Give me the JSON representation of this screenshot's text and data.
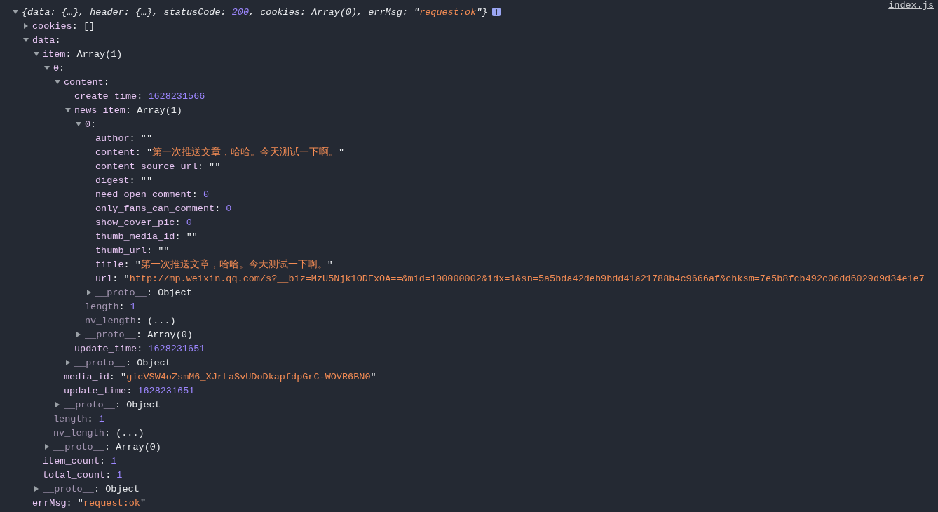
{
  "console": {
    "source_link": "index.js",
    "entry": {
      "expanded": true,
      "preview": [
        {
          "kind": "plain",
          "text": "{data: {…}, header: {…}, statusCode: "
        },
        {
          "kind": "number",
          "text": "200"
        },
        {
          "kind": "plain",
          "text": ", cookies: Array(0), errMsg: "
        },
        {
          "kind": "quote",
          "text": "\""
        },
        {
          "kind": "string",
          "text": "request:ok"
        },
        {
          "kind": "quote",
          "text": "\""
        },
        {
          "kind": "plain",
          "text": "}"
        }
      ],
      "children": [
        {
          "kind": "branch",
          "expanded": false,
          "dimmed": false,
          "key": "cookies:",
          "value": [
            {
              "kind": "plain",
              "text": "[]"
            }
          ]
        },
        {
          "kind": "branch",
          "expanded": true,
          "dimmed": false,
          "key": "data:",
          "children": [
            {
              "kind": "branch",
              "expanded": true,
              "dimmed": false,
              "key": "item:",
              "value": [
                {
                  "kind": "plain",
                  "text": "Array(1)"
                }
              ],
              "children": [
                {
                  "kind": "branch",
                  "expanded": true,
                  "dimmed": false,
                  "key": "0:",
                  "children": [
                    {
                      "kind": "branch",
                      "expanded": true,
                      "dimmed": false,
                      "key": "content:",
                      "children": [
                        {
                          "kind": "leaf",
                          "dimmed": false,
                          "key": "create_time:",
                          "value": [
                            {
                              "kind": "number",
                              "text": "1628231566"
                            }
                          ]
                        },
                        {
                          "kind": "branch",
                          "expanded": true,
                          "dimmed": false,
                          "key": "news_item:",
                          "value": [
                            {
                              "kind": "plain",
                              "text": "Array(1)"
                            }
                          ],
                          "children": [
                            {
                              "kind": "branch",
                              "expanded": true,
                              "dimmed": false,
                              "key": "0:",
                              "children": [
                                {
                                  "kind": "leaf",
                                  "dimmed": false,
                                  "key": "author:",
                                  "value": [
                                    {
                                      "kind": "quote",
                                      "text": "\"\""
                                    }
                                  ]
                                },
                                {
                                  "kind": "leaf",
                                  "dimmed": false,
                                  "key": "content:",
                                  "value": [
                                    {
                                      "kind": "quote",
                                      "text": "\""
                                    },
                                    {
                                      "kind": "string",
                                      "text": "第一次推送文章，哈哈。今天测试一下啊。"
                                    },
                                    {
                                      "kind": "quote",
                                      "text": "\""
                                    }
                                  ]
                                },
                                {
                                  "kind": "leaf",
                                  "dimmed": false,
                                  "key": "content_source_url:",
                                  "value": [
                                    {
                                      "kind": "quote",
                                      "text": "\"\""
                                    }
                                  ]
                                },
                                {
                                  "kind": "leaf",
                                  "dimmed": false,
                                  "key": "digest:",
                                  "value": [
                                    {
                                      "kind": "quote",
                                      "text": "\"\""
                                    }
                                  ]
                                },
                                {
                                  "kind": "leaf",
                                  "dimmed": false,
                                  "key": "need_open_comment:",
                                  "value": [
                                    {
                                      "kind": "number",
                                      "text": "0"
                                    }
                                  ]
                                },
                                {
                                  "kind": "leaf",
                                  "dimmed": false,
                                  "key": "only_fans_can_comment:",
                                  "value": [
                                    {
                                      "kind": "number",
                                      "text": "0"
                                    }
                                  ]
                                },
                                {
                                  "kind": "leaf",
                                  "dimmed": false,
                                  "key": "show_cover_pic:",
                                  "value": [
                                    {
                                      "kind": "number",
                                      "text": "0"
                                    }
                                  ]
                                },
                                {
                                  "kind": "leaf",
                                  "dimmed": false,
                                  "key": "thumb_media_id:",
                                  "value": [
                                    {
                                      "kind": "quote",
                                      "text": "\"\""
                                    }
                                  ]
                                },
                                {
                                  "kind": "leaf",
                                  "dimmed": false,
                                  "key": "thumb_url:",
                                  "value": [
                                    {
                                      "kind": "quote",
                                      "text": "\"\""
                                    }
                                  ]
                                },
                                {
                                  "kind": "leaf",
                                  "dimmed": false,
                                  "key": "title:",
                                  "value": [
                                    {
                                      "kind": "quote",
                                      "text": "\""
                                    },
                                    {
                                      "kind": "string",
                                      "text": "第一次推送文章，哈哈。今天测试一下啊。"
                                    },
                                    {
                                      "kind": "quote",
                                      "text": "\""
                                    }
                                  ]
                                },
                                {
                                  "kind": "leaf",
                                  "dimmed": false,
                                  "key": "url:",
                                  "value": [
                                    {
                                      "kind": "quote",
                                      "text": "\""
                                    },
                                    {
                                      "kind": "string",
                                      "text": "http://mp.weixin.qq.com/s?__biz=MzU5Njk1ODExOA==&mid=100000002&idx=1&sn=5a5bda42deb9bdd41a21788b4c9666af&chksm=7e5b8fcb492c06dd6029d9d34e1e7"
                                    }
                                  ]
                                },
                                {
                                  "kind": "branch",
                                  "expanded": false,
                                  "dimmed": true,
                                  "key": "__proto__:",
                                  "value": [
                                    {
                                      "kind": "plain",
                                      "text": "Object"
                                    }
                                  ]
                                }
                              ]
                            },
                            {
                              "kind": "leaf",
                              "dimmed": true,
                              "key": "length:",
                              "value": [
                                {
                                  "kind": "number",
                                  "text": "1"
                                }
                              ]
                            },
                            {
                              "kind": "leaf",
                              "dimmed": true,
                              "key": "nv_length:",
                              "value": [
                                {
                                  "kind": "plain",
                                  "text": "(...)"
                                }
                              ]
                            },
                            {
                              "kind": "branch",
                              "expanded": false,
                              "dimmed": true,
                              "key": "__proto__:",
                              "value": [
                                {
                                  "kind": "plain",
                                  "text": "Array(0)"
                                }
                              ]
                            }
                          ]
                        },
                        {
                          "kind": "leaf",
                          "dimmed": false,
                          "key": "update_time:",
                          "value": [
                            {
                              "kind": "number",
                              "text": "1628231651"
                            }
                          ]
                        },
                        {
                          "kind": "branch",
                          "expanded": false,
                          "dimmed": true,
                          "key": "__proto__:",
                          "value": [
                            {
                              "kind": "plain",
                              "text": "Object"
                            }
                          ]
                        }
                      ]
                    },
                    {
                      "kind": "leaf",
                      "dimmed": false,
                      "key": "media_id:",
                      "value": [
                        {
                          "kind": "quote",
                          "text": "\""
                        },
                        {
                          "kind": "string",
                          "text": "gicVSW4oZsmM6_XJrLaSvUDoDkapfdpGrC-WOVR6BN0"
                        },
                        {
                          "kind": "quote",
                          "text": "\""
                        }
                      ]
                    },
                    {
                      "kind": "leaf",
                      "dimmed": false,
                      "key": "update_time:",
                      "value": [
                        {
                          "kind": "number",
                          "text": "1628231651"
                        }
                      ]
                    },
                    {
                      "kind": "branch",
                      "expanded": false,
                      "dimmed": true,
                      "key": "__proto__:",
                      "value": [
                        {
                          "kind": "plain",
                          "text": "Object"
                        }
                      ]
                    }
                  ]
                },
                {
                  "kind": "leaf",
                  "dimmed": true,
                  "key": "length:",
                  "value": [
                    {
                      "kind": "number",
                      "text": "1"
                    }
                  ]
                },
                {
                  "kind": "leaf",
                  "dimmed": true,
                  "key": "nv_length:",
                  "value": [
                    {
                      "kind": "plain",
                      "text": "(...)"
                    }
                  ]
                },
                {
                  "kind": "branch",
                  "expanded": false,
                  "dimmed": true,
                  "key": "__proto__:",
                  "value": [
                    {
                      "kind": "plain",
                      "text": "Array(0)"
                    }
                  ]
                }
              ]
            },
            {
              "kind": "leaf",
              "dimmed": false,
              "key": "item_count:",
              "value": [
                {
                  "kind": "number",
                  "text": "1"
                }
              ]
            },
            {
              "kind": "leaf",
              "dimmed": false,
              "key": "total_count:",
              "value": [
                {
                  "kind": "number",
                  "text": "1"
                }
              ]
            },
            {
              "kind": "branch",
              "expanded": false,
              "dimmed": true,
              "key": "__proto__:",
              "value": [
                {
                  "kind": "plain",
                  "text": "Object"
                }
              ]
            }
          ]
        },
        {
          "kind": "leaf",
          "dimmed": false,
          "key": "errMsg:",
          "value": [
            {
              "kind": "quote",
              "text": "\""
            },
            {
              "kind": "string",
              "text": "request:ok"
            },
            {
              "kind": "quote",
              "text": "\""
            }
          ]
        }
      ]
    }
  }
}
